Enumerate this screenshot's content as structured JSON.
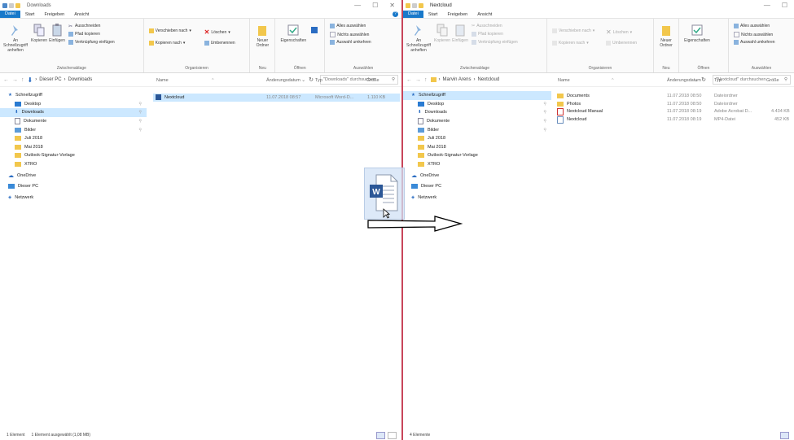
{
  "left": {
    "title": "Downloads",
    "menu": [
      "Datei",
      "Start",
      "Freigeben",
      "Ansicht"
    ],
    "ribbon": {
      "clipboard": {
        "pin": "An Schnellzugriff anheften",
        "copy": "Kopieren",
        "paste": "Einfügen",
        "cut": "Ausschneiden",
        "copy_path": "Pfad kopieren",
        "paste_link": "Verknüpfung einfügen",
        "label": "Zwischenablage"
      },
      "organize": {
        "move": "Verschieben nach",
        "copy_to": "Kopieren nach",
        "delete": "Löschen",
        "rename": "Umbenennen",
        "label": "Organisieren"
      },
      "new": {
        "folder": "Neuer Ordner",
        "label": "Neu"
      },
      "open": {
        "props": "Eigenschaften",
        "label": "Öffnen"
      },
      "select": {
        "all": "Alles auswählen",
        "none": "Nichts auswählen",
        "invert": "Auswahl umkehren",
        "label": "Auswählen"
      }
    },
    "address": {
      "parts": [
        "Dieser PC",
        "Downloads"
      ],
      "search": "\"Downloads\" durchsuchen"
    },
    "nav": [
      "Schnellzugriff",
      "Desktop",
      "Downloads",
      "Dokumente",
      "Bilder",
      "Juli 2018",
      "Mai 2018",
      "Outlook-Signatur-Vorlage",
      "XTRO",
      "OneDrive",
      "Dieser PC",
      "Netzwerk"
    ],
    "columns": {
      "name": "Name",
      "date": "Änderungsdatum",
      "type": "Typ",
      "size": "Größe"
    },
    "files": [
      {
        "name": "Nextcloud",
        "date": "11.07.2018 08:57",
        "type": "Microsoft Word-D...",
        "size": "1.110 KB"
      }
    ],
    "status": {
      "count": "1 Element",
      "selected": "1 Element ausgewählt (1,08 MB)"
    }
  },
  "right": {
    "title": "Nextcloud",
    "menu": [
      "Datei",
      "Start",
      "Freigeben",
      "Ansicht"
    ],
    "ribbon": {
      "clipboard": {
        "pin": "An Schnellzugriff anheften",
        "copy": "Kopieren",
        "paste": "Einfügen",
        "cut": "Ausschneiden",
        "copy_path": "Pfad kopieren",
        "paste_link": "Verknüpfung einfügen",
        "label": "Zwischenablage"
      },
      "organize": {
        "move": "Verschieben nach",
        "copy_to": "Kopieren nach",
        "delete": "Löschen",
        "rename": "Umbenennen",
        "label": "Organisieren"
      },
      "new": {
        "folder": "Neuer Ordner",
        "label": "Neu"
      },
      "open": {
        "props": "Eigenschaften",
        "label": "Öffnen"
      },
      "select": {
        "all": "Alles auswählen",
        "none": "Nichts auswählen",
        "invert": "Auswahl umkehren",
        "label": "Auswählen"
      }
    },
    "address": {
      "parts": [
        "Marvin Arens",
        "Nextcloud"
      ],
      "search": "\"Nextcloud\" durchsuchen"
    },
    "nav": [
      "Schnellzugriff",
      "Desktop",
      "Downloads",
      "Dokumente",
      "Bilder",
      "Juli 2018",
      "Mai 2018",
      "Outlook-Signatur-Vorlage",
      "XTRO",
      "OneDrive",
      "Dieser PC",
      "Netzwerk"
    ],
    "columns": {
      "name": "Name",
      "date": "Änderungsdatum",
      "type": "Typ",
      "size": "Größe"
    },
    "files": [
      {
        "name": "Documents",
        "date": "11.07.2018 08:50",
        "type": "Dateiordner",
        "size": ""
      },
      {
        "name": "Photos",
        "date": "11.07.2018 08:50",
        "type": "Dateiordner",
        "size": ""
      },
      {
        "name": "Nextcloud Manual",
        "date": "11.07.2018 08:19",
        "type": "Adobe Acrobat D...",
        "size": "4.434 KB"
      },
      {
        "name": "Nextcloud",
        "date": "11.07.2018 08:19",
        "type": "MP4-Datei",
        "size": "452 KB"
      }
    ],
    "status": {
      "count": "4 Elemente"
    }
  },
  "drag": {
    "icon": "word-document-icon",
    "letter": "W"
  },
  "colors": {
    "accent": "#1979ca",
    "selection": "#cce8ff",
    "folder": "#f2c74c",
    "divider": "#c8455a"
  }
}
